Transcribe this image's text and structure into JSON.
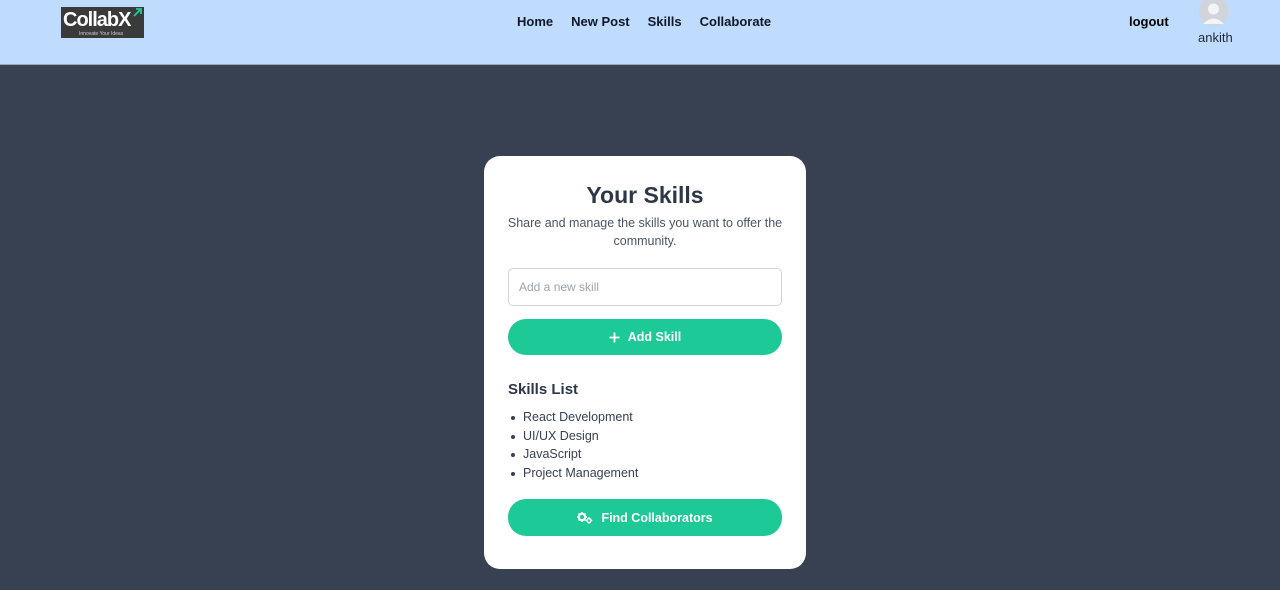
{
  "brand": {
    "name": "CollabX",
    "tagline": "Innovate Your Ideas",
    "accent_color": "#1ec998"
  },
  "nav": {
    "links": [
      {
        "label": "Home"
      },
      {
        "label": "New Post"
      },
      {
        "label": "Skills"
      },
      {
        "label": "Collaborate"
      }
    ]
  },
  "user": {
    "logout_label": "logout",
    "username": "ankith",
    "avatar_icon": "user-avatar-icon"
  },
  "skills_card": {
    "title": "Your Skills",
    "subtitle": "Share and manage the skills you want to offer the community.",
    "input": {
      "placeholder": "Add a new skill",
      "value": ""
    },
    "add_button": {
      "label": "Add Skill",
      "icon": "plus-icon"
    },
    "list_heading": "Skills List",
    "skills": [
      "React Development",
      "UI/UX Design",
      "JavaScript",
      "Project Management"
    ],
    "find_button": {
      "label": "Find Collaborators",
      "icon": "gears-icon"
    }
  },
  "colors": {
    "navbar_bg": "#bfdbfe",
    "page_bg": "#374151",
    "card_bg": "#ffffff",
    "button_bg": "#1ec998"
  }
}
